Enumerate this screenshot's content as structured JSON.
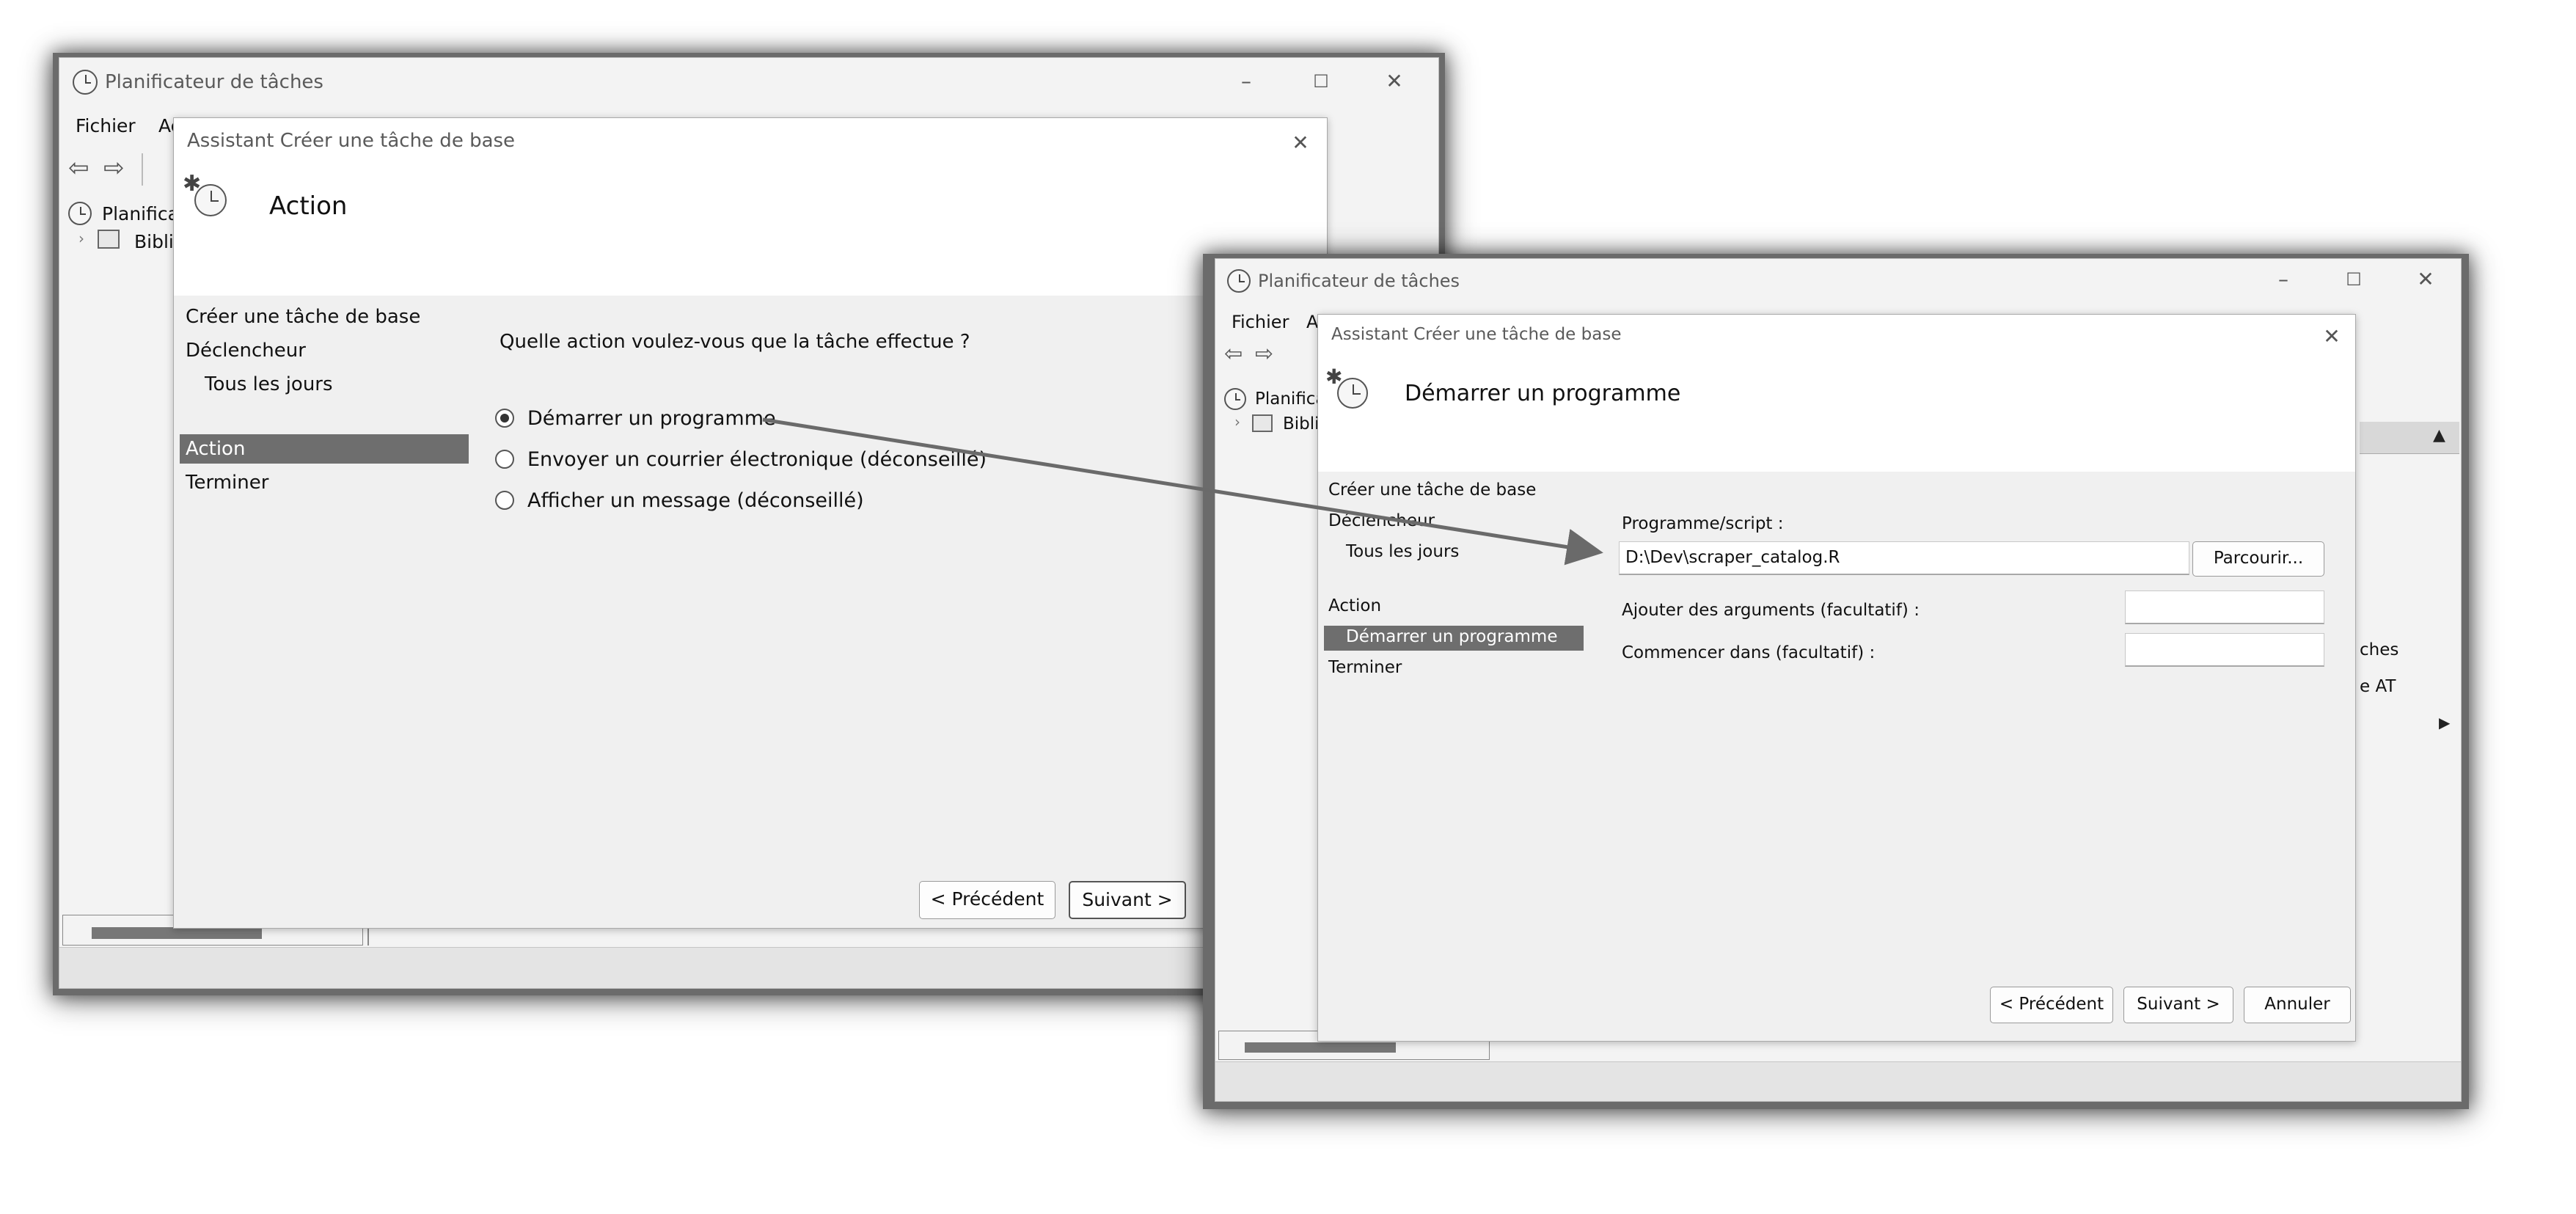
{
  "left_window": {
    "app_title": "Planificateur de tâches",
    "menu_file": "Fichier",
    "menu_action_partial": "Ac",
    "tree_root_partial": "Planifica",
    "tree_lib_partial": "Biblio",
    "dialog": {
      "title": "Assistant Créer une tâche de base",
      "heading": "Action",
      "steps": [
        "Créer une tâche de base",
        "Déclencheur",
        "Tous les jours",
        "Action",
        "Terminer"
      ],
      "question": "Quelle action voulez-vous que la tâche effectue ?",
      "options": [
        "Démarrer un programme",
        "Envoyer un courrier électronique (déconseillé)",
        "Afficher un message (déconseillé)"
      ],
      "selected_option": "Démarrer un programme",
      "back_button": "< Précédent",
      "next_button": "Suivant >"
    }
  },
  "right_window": {
    "app_title": "Planificateur de tâches",
    "menu_file": "Fichier",
    "menu_action_partial": "Ac",
    "tree_root_partial": "Planifica",
    "tree_lib_partial": "Biblio",
    "behind_text_1": "ches",
    "behind_text_2": "e AT",
    "dialog": {
      "title": "Assistant Créer une tâche de base",
      "heading": "Démarrer un programme",
      "steps": [
        "Créer une tâche de base",
        "Déclencheur",
        "Tous les jours",
        "Action",
        "Démarrer un programme",
        "Terminer"
      ],
      "program_label": "Programme/script :",
      "program_value": "D:\\Dev\\scraper_catalog.R",
      "browse_button": "Parcourir...",
      "args_label": "Ajouter des arguments (facultatif) :",
      "args_value": "",
      "start_in_label": "Commencer dans (facultatif) :",
      "start_in_value": "",
      "back_button": "< Précédent",
      "next_button": "Suivant >",
      "cancel_button": "Annuler"
    }
  },
  "icons": {
    "app": "clock-icon",
    "wizard": "task-wizard-icon",
    "close": "close-icon",
    "minimize": "minimize-icon",
    "maximize": "maximize-icon",
    "back_arrow": "back-arrow-icon",
    "forward_arrow": "forward-arrow-icon",
    "library": "library-icon"
  },
  "colors": {
    "selection": "#6e6e6e",
    "dialog_body": "#f0f0f0",
    "arrow": "#6a6a6a"
  }
}
